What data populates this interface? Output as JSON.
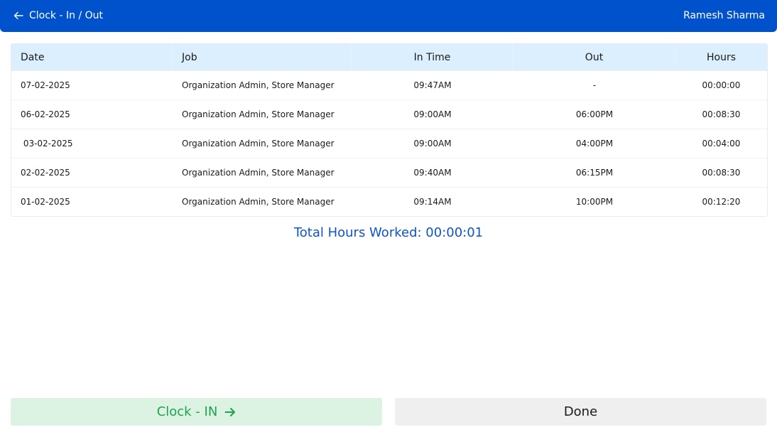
{
  "header": {
    "title": "Clock - In / Out",
    "user_name": "Ramesh Sharma",
    "back_icon": "arrow-left-icon"
  },
  "table": {
    "columns": [
      "Date",
      "Job",
      "In Time",
      "Out",
      "Hours"
    ],
    "rows": [
      {
        "date": "07-02-2025",
        "job": "Organization Admin, Store Manager",
        "in": "09:47AM",
        "out": "-",
        "hours": "00:00:00"
      },
      {
        "date": "06-02-2025",
        "job": "Organization Admin, Store Manager",
        "in": "09:00AM",
        "out": "06:00PM",
        "hours": "00:08:30"
      },
      {
        "date": " 03-02-2025",
        "job": "Organization Admin, Store Manager",
        "in": "09:00AM",
        "out": "04:00PM",
        "hours": "00:04:00"
      },
      {
        "date": "02-02-2025",
        "job": "Organization Admin, Store Manager",
        "in": "09:40AM",
        "out": "06:15PM",
        "hours": "00:08:30"
      },
      {
        "date": "01-02-2025",
        "job": "Organization Admin, Store Manager",
        "in": "09:14AM",
        "out": "10:00PM",
        "hours": "00:12:20"
      }
    ]
  },
  "total": {
    "text": "Total Hours Worked: 00:00:01"
  },
  "buttons": {
    "clock_in": "Clock - IN",
    "done": "Done"
  },
  "colors": {
    "header_bg": "#0052cc",
    "table_header_bg": "#dcefff",
    "total_text": "#0d55c8",
    "clock_in_bg": "#dcf3e3",
    "clock_in_text": "#1ea34d",
    "done_bg": "#efefef"
  }
}
